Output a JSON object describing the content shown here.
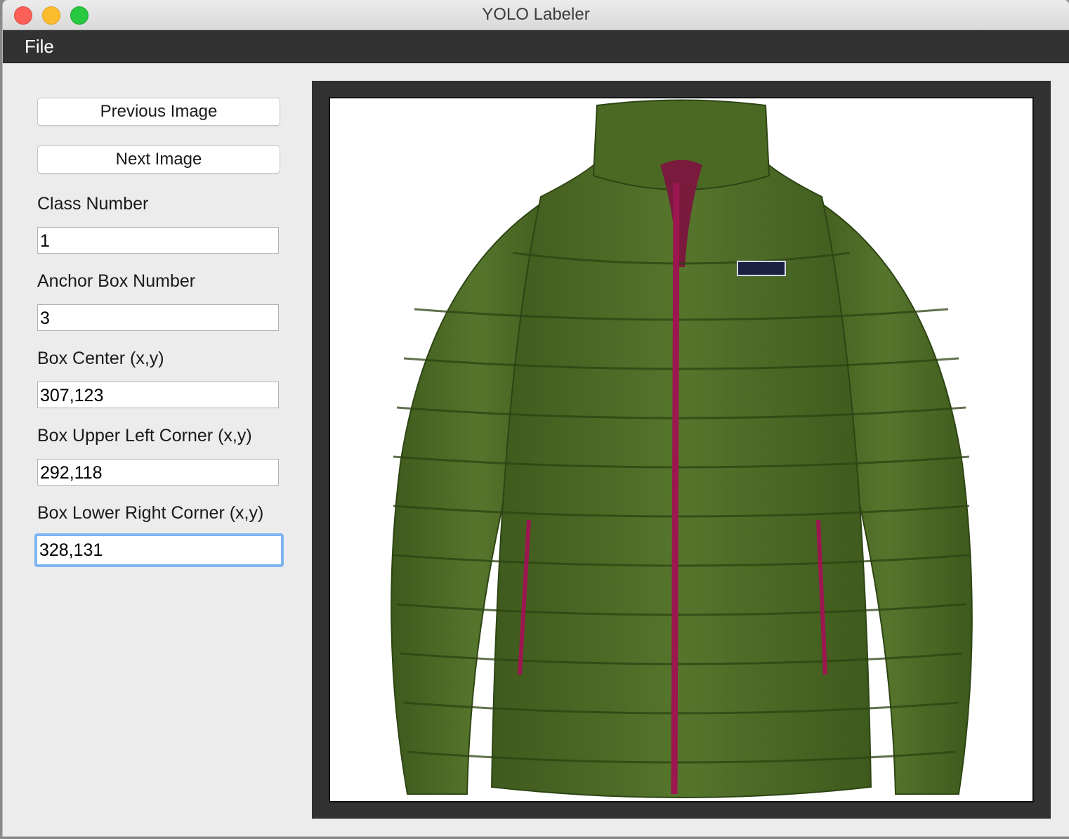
{
  "window": {
    "title": "YOLO Labeler"
  },
  "menubar": {
    "file_label": "File"
  },
  "controls": {
    "previous_label": "Previous Image",
    "next_label": "Next Image"
  },
  "fields": [
    {
      "label": "Class Number",
      "value": "1"
    },
    {
      "label": "Anchor Box Number",
      "value": "3"
    },
    {
      "label": "Box Center (x,y)",
      "value": "307,123"
    },
    {
      "label": "Box Upper Left Corner (x,y)",
      "value": "292,118"
    },
    {
      "label": "Box Lower Right Corner (x,y)",
      "value": "328,131"
    }
  ],
  "image": {
    "jacket_color": "#4f6e28",
    "zipper_color": "#9c1650"
  },
  "colors": {
    "menubar": "#323232",
    "frame": "#323232",
    "focus_ring": "#7eb4f1"
  }
}
